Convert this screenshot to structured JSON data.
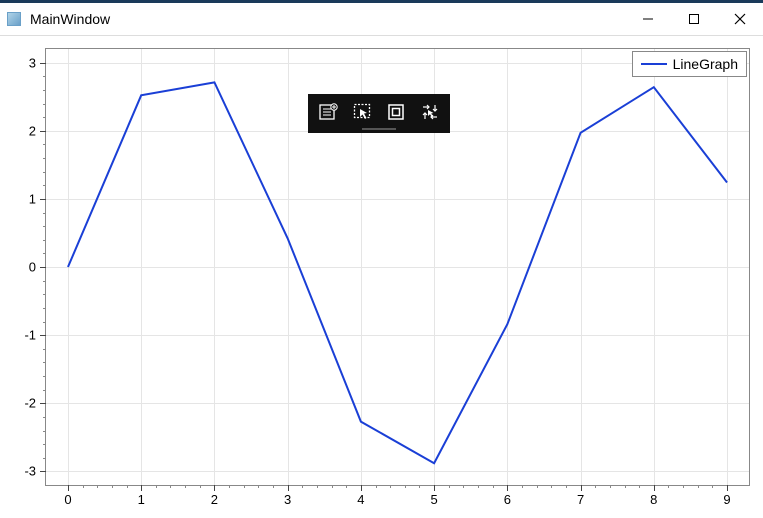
{
  "window": {
    "title": "MainWindow"
  },
  "toolbar": {
    "items": [
      "options",
      "cursor-select",
      "frame",
      "free-transform"
    ]
  },
  "legend": {
    "label": "LineGraph"
  },
  "axes": {
    "x_ticks": [
      "0",
      "1",
      "2",
      "3",
      "4",
      "5",
      "6",
      "7",
      "8",
      "9"
    ],
    "y_ticks": [
      "-3",
      "-2",
      "-1",
      "0",
      "1",
      "2",
      "3"
    ]
  },
  "chart_data": {
    "type": "line",
    "title": "",
    "xlabel": "",
    "ylabel": "",
    "xlim": [
      -0.3,
      9.3
    ],
    "ylim": [
      -3.2,
      3.2
    ],
    "series": [
      {
        "name": "LineGraph",
        "color": "#1a3fd6",
        "x": [
          0,
          1,
          2,
          3,
          4,
          5,
          6,
          7,
          8,
          9
        ],
        "y": [
          0.0,
          2.52,
          2.71,
          0.42,
          -2.27,
          -2.88,
          -0.84,
          1.97,
          2.64,
          1.24
        ]
      }
    ]
  }
}
